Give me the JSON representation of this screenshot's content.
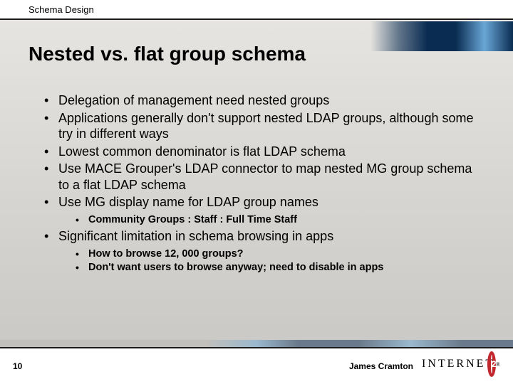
{
  "header": {
    "section": "Schema Design"
  },
  "title": "Nested vs. flat group schema",
  "bullets": {
    "b0": "Delegation of management need nested groups",
    "b1": "Applications generally don't support nested LDAP groups, although some try in different ways",
    "b2": "Lowest common denominator is flat LDAP schema",
    "b3": "Use MACE Grouper's LDAP connector to map nested MG group schema to a flat LDAP schema",
    "b4": "Use MG display name for LDAP group names",
    "b4_sub0": "Community Groups : Staff : Full Time Staff",
    "b5": "Significant limitation in schema browsing in apps",
    "b5_sub0": "How to browse 12, 000 groups?",
    "b5_sub1": "Don't want users to browse anyway; need to disable in apps"
  },
  "footer": {
    "slide_number": "10",
    "author": "James Cramton",
    "logo_text": "INTERNET",
    "logo_badge": "2"
  }
}
